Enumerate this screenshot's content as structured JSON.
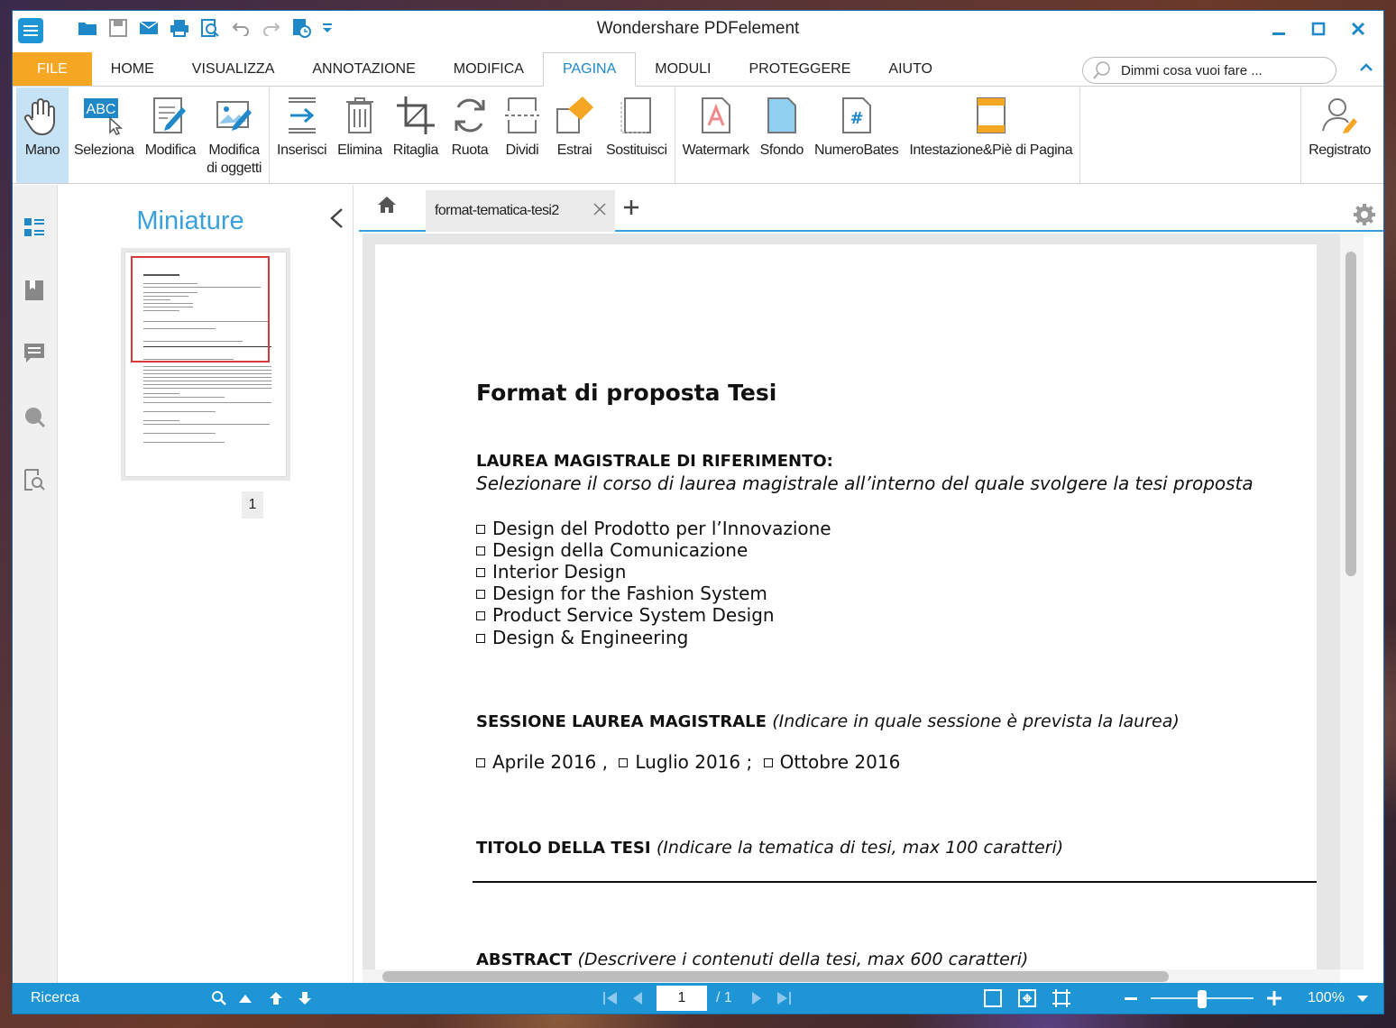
{
  "window": {
    "title": "Wondershare PDFelement"
  },
  "menu": {
    "file": "FILE",
    "tabs": [
      "HOME",
      "VISUALIZZA",
      "ANNOTAZIONE",
      "MODIFICA",
      "PAGINA",
      "MODULI",
      "PROTEGGERE",
      "AIUTO"
    ],
    "active_tab": "PAGINA",
    "search_placeholder": "Dimmi cosa vuoi fare ..."
  },
  "ribbon": {
    "mano": "Mano",
    "seleziona": "Seleziona",
    "modifica": "Modifica",
    "modifica_oggetti_1": "Modifica",
    "modifica_oggetti_2": "di oggetti",
    "inserisci": "Inserisci",
    "elimina": "Elimina",
    "ritaglia": "Ritaglia",
    "ruota": "Ruota",
    "dividi": "Dividi",
    "estrai": "Estrai",
    "sostituisci": "Sostituisci",
    "watermark": "Watermark",
    "sfondo": "Sfondo",
    "numero_bates": "NumeroBates",
    "intestazione": "Intestazione&Piè di Pagina",
    "registrato": "Registrato",
    "abc_badge": "ABC"
  },
  "thumbnails": {
    "title": "Miniature",
    "page_number": "1"
  },
  "document": {
    "tab_name": "format-tematica-tesi2",
    "title": "Format di proposta Tesi",
    "laurea_heading": "LAUREA MAGISTRALE DI RIFERIMENTO:",
    "laurea_instruction": "Selezionare il corso di laurea magistrale all’interno del quale svolgere la tesi proposta",
    "courses": [
      "Design del Prodotto per l’Innovazione",
      "Design della Comunicazione",
      "Interior Design",
      "Design for the Fashion System",
      "Product Service System Design",
      "Design & Engineering"
    ],
    "sessione_heading": "SESSIONE LAUREA MAGISTRALE",
    "sessione_note": "(Indicare in quale sessione è prevista la laurea)",
    "sessioni": [
      "Aprile 2016 ,",
      "Luglio 2016 ;",
      "Ottobre 2016"
    ],
    "titolo_heading": "TITOLO DELLA TESI",
    "titolo_note": "(Indicare la tematica di tesi, max 100 caratteri)",
    "abstract_heading": "ABSTRACT",
    "abstract_note": "(Descrivere i contenuti della tesi, max 600 caratteri)"
  },
  "status": {
    "search_label": "Ricerca",
    "current_page": "1",
    "total_pages": "/ 1",
    "zoom": "100%",
    "zoom_fraction": 0.5
  },
  "colors": {
    "accent": "#1e96d6",
    "file_tab": "#f5a623",
    "thumb_selection": "#d63a3a"
  }
}
